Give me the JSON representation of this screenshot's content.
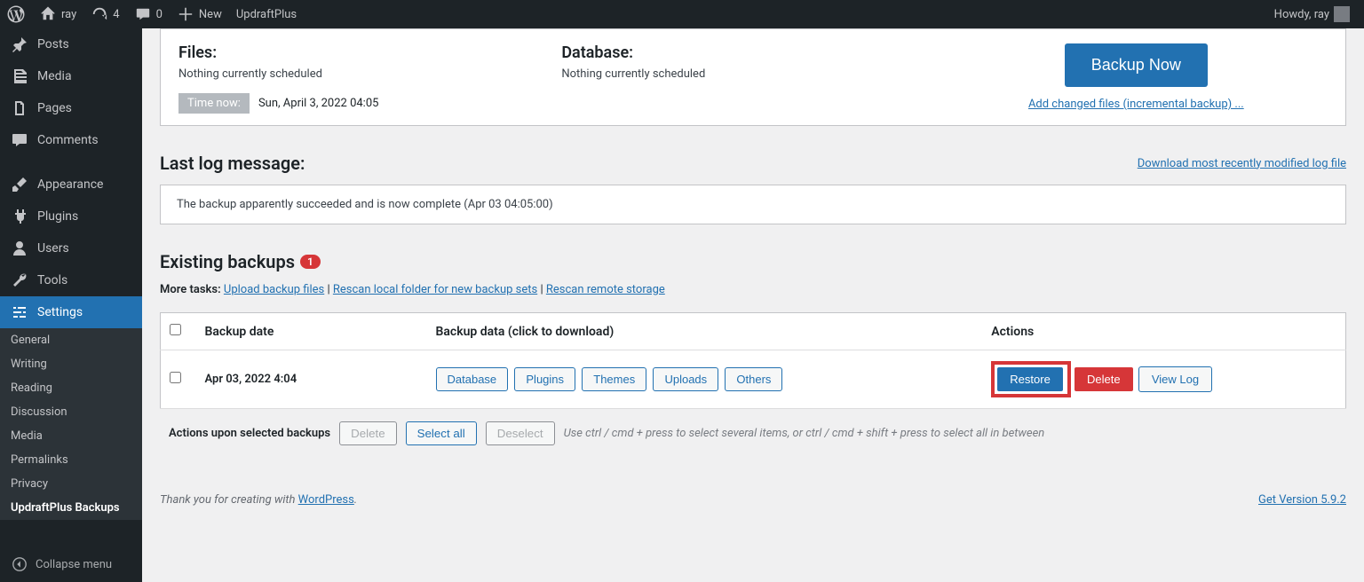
{
  "adminbar": {
    "site": "ray",
    "updates": "4",
    "comments": "0",
    "new": "New",
    "plugin": "UpdraftPlus",
    "howdy": "Howdy, ray"
  },
  "menu": {
    "posts": "Posts",
    "media": "Media",
    "pages": "Pages",
    "comments": "Comments",
    "appearance": "Appearance",
    "plugins": "Plugins",
    "users": "Users",
    "tools": "Tools",
    "settings": "Settings",
    "collapse": "Collapse menu"
  },
  "submenu": {
    "general": "General",
    "writing": "Writing",
    "reading": "Reading",
    "discussion": "Discussion",
    "media": "Media",
    "permalinks": "Permalinks",
    "privacy": "Privacy",
    "updraft": "UpdraftPlus Backups"
  },
  "status": {
    "files_title": "Files:",
    "files_text": "Nothing currently scheduled",
    "db_title": "Database:",
    "db_text": "Nothing currently scheduled",
    "time_label": "Time now:",
    "time_value": "Sun, April 3, 2022 04:05",
    "backup_now": "Backup Now",
    "incremental": "Add changed files (incremental backup) ..."
  },
  "log": {
    "heading": "Last log message:",
    "download_link": "Download most recently modified log file",
    "message": "The backup apparently succeeded and is now complete (Apr 03 04:05:00)"
  },
  "existing": {
    "heading": "Existing backups",
    "count": "1",
    "more_tasks_label": "More tasks",
    "upload": "Upload backup files",
    "rescan_local": "Rescan local folder for new backup sets",
    "rescan_remote": "Rescan remote storage"
  },
  "table": {
    "col_date": "Backup date",
    "col_data": "Backup data (click to download)",
    "col_actions": "Actions",
    "row": {
      "date": "Apr 03, 2022 4:04",
      "btns": {
        "db": "Database",
        "plugins": "Plugins",
        "themes": "Themes",
        "uploads": "Uploads",
        "others": "Others"
      },
      "restore": "Restore",
      "delete": "Delete",
      "viewlog": "View Log"
    }
  },
  "bulk": {
    "label": "Actions upon selected backups",
    "delete": "Delete",
    "select_all": "Select all",
    "deselect": "Deselect",
    "hint": "Use ctrl / cmd + press to select several items, or ctrl / cmd + shift + press to select all in between"
  },
  "footer": {
    "thanks_pre": "Thank you for creating with ",
    "wp": "WordPress",
    "version": "Get Version 5.9.2"
  }
}
